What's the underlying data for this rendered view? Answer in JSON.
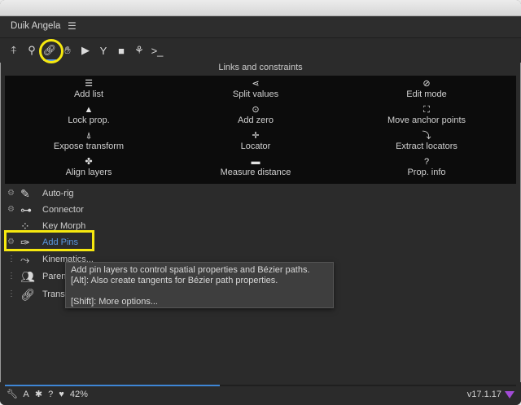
{
  "window": {
    "title": ""
  },
  "panel": {
    "name": "Duik Angela",
    "menu_icon": "hamburger-icon"
  },
  "toolbar": {
    "tools": [
      "rig-icon",
      "bone-icon",
      "link-icon",
      "hand-icon",
      "play-icon",
      "branch-icon",
      "camera-icon",
      "walk-icon",
      "script-icon"
    ],
    "active_tool": "link-icon",
    "right_icon": "document-icon"
  },
  "section": {
    "title": "Links and constraints",
    "items": [
      {
        "label": "Add list",
        "icon": "list-icon"
      },
      {
        "label": "Split values",
        "icon": "share-icon"
      },
      {
        "label": "Edit mode",
        "icon": "eye-off-icon"
      },
      {
        "label": "Lock prop.",
        "icon": "lock-icon"
      },
      {
        "label": "Add zero",
        "icon": "zero-icon"
      },
      {
        "label": "Move anchor points",
        "icon": "anchor-icon"
      },
      {
        "label": "Expose transform",
        "icon": "compass-icon"
      },
      {
        "label": "Locator",
        "icon": "crosshair-icon"
      },
      {
        "label": "Extract locators",
        "icon": "extract-icon"
      },
      {
        "label": "Align layers",
        "icon": "align-icon"
      },
      {
        "label": "Measure distance",
        "icon": "ruler-icon"
      },
      {
        "label": "Prop. info",
        "icon": "question-icon"
      }
    ]
  },
  "tools_list": [
    {
      "label": "Auto-rig",
      "icon": "wand-icon"
    },
    {
      "label": "Connector",
      "icon": "connector-icon"
    },
    {
      "label": "Key Morph",
      "icon": "morph-icon"
    },
    {
      "label": "Add Pins",
      "icon": "pin-icon"
    },
    {
      "label": "Kinematics...",
      "icon": "kinematics-icon"
    },
    {
      "label": "Parent",
      "icon": "parent-icon"
    },
    {
      "label": "Transf",
      "icon": "link-icon"
    }
  ],
  "selected_tool": "Add Pins",
  "tooltip": {
    "line1": "Add pin layers to control spatial properties and Bézier paths.",
    "line2": "[Alt]: Also create tangents for Bézier path properties.",
    "line3": "[Shift]: More options..."
  },
  "status": {
    "progress_percent": 42,
    "progress_label": "42%",
    "version": "v17.1.17",
    "accent": "#3e86d6",
    "highlight": "#f6e80f"
  }
}
